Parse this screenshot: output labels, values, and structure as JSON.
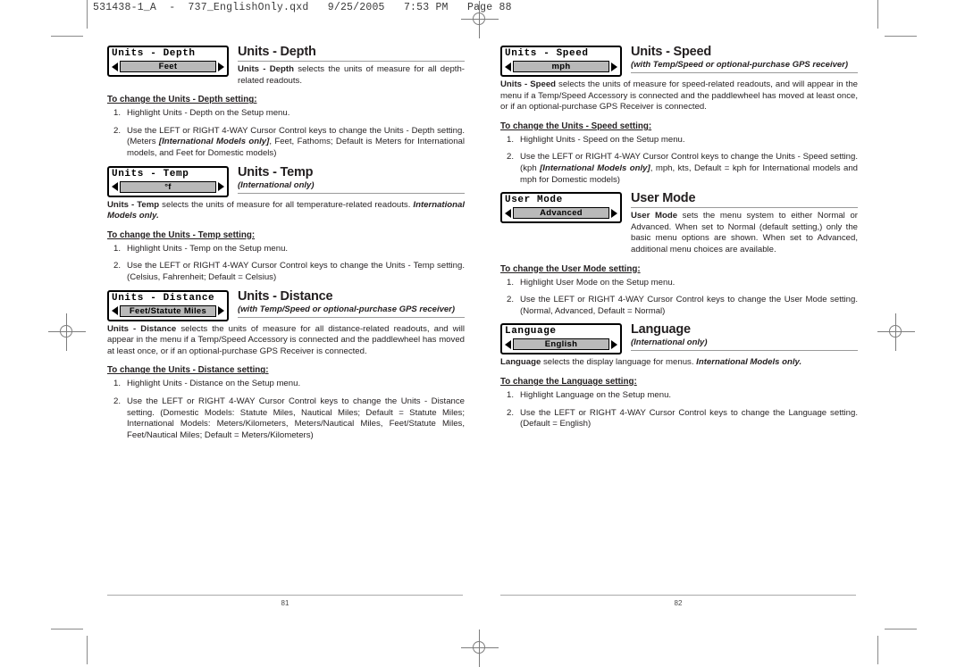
{
  "file_header": "531438-1_A  -  737_EnglishOnly.qxd   9/25/2005   7:53 PM   Page 88",
  "pages": {
    "left": {
      "number": "81"
    },
    "right": {
      "number": "82"
    }
  },
  "entries": [
    {
      "id": "units-depth",
      "column": "left",
      "lcd": {
        "title": "Units - Depth",
        "value": "Feet",
        "left_arrow": "left-arrow-icon",
        "right_arrow": "right-arrow-icon"
      },
      "title": "Units - Depth",
      "subtitle": "",
      "description_html": "<b>Units - Depth</b> selects the units of measure for all depth-related readouts.",
      "description_flow": "indent",
      "steps_title": "To change the Units - Depth setting:",
      "steps": [
        "Highlight Units - Depth on the Setup menu.",
        "Use the LEFT or RIGHT 4-WAY Cursor Control keys to change the Units - Depth setting. (Meters <span class=\"bi\">[International Models only]</span>, Feet, Fathoms; Default is Meters for International models, and Feet for Domestic models)"
      ]
    },
    {
      "id": "units-temp",
      "column": "left",
      "lcd": {
        "title": "Units - Temp",
        "value": "°f",
        "left_arrow": "left-arrow-icon",
        "right_arrow": "right-arrow-icon"
      },
      "title": "Units - Temp",
      "subtitle": "(International only)",
      "description_html": "<b>Units - Temp</b> selects the units of measure for all temperature-related readouts. <span class=\"bi\">International Models only.</span>",
      "description_flow": "full",
      "steps_title": "To change the Units - Temp setting:",
      "steps": [
        "Highlight Units - Temp on the Setup menu.",
        "Use the LEFT or RIGHT 4-WAY Cursor Control keys to change the Units - Temp setting. (Celsius, Fahrenheit; Default = Celsius)"
      ]
    },
    {
      "id": "units-distance",
      "column": "left",
      "lcd": {
        "title": "Units - Distance",
        "value": "Feet/Statute Miles",
        "left_arrow": "left-arrow-icon",
        "right_arrow": "right-arrow-icon"
      },
      "title": "Units - Distance",
      "subtitle": "(with Temp/Speed or optional-purchase GPS receiver)",
      "description_html": "<b>Units - Distance</b> selects the units of measure for all distance-related readouts, and will appear in the menu if a Temp/Speed Accessory is connected and the paddlewheel has moved at least once, or if an optional-purchase GPS Receiver is connected.",
      "description_flow": "full",
      "steps_title": "To change the Units - Distance setting:",
      "steps": [
        "Highlight Units - Distance on the Setup menu.",
        "Use the LEFT or RIGHT 4-WAY Cursor Control keys to change the Units - Distance setting. (Domestic Models: Statute Miles, Nautical Miles; Default = Statute Miles; International Models: Meters/Kilometers, Meters/Nautical Miles, Feet/Statute Miles, Feet/Nautical Miles; Default = Meters/Kilometers)"
      ]
    },
    {
      "id": "units-speed",
      "column": "right",
      "lcd": {
        "title": "Units - Speed",
        "value": "mph",
        "left_arrow": "left-arrow-icon",
        "right_arrow": "right-arrow-icon"
      },
      "title": "Units - Speed",
      "subtitle": "(with Temp/Speed or optional-purchase GPS receiver)",
      "description_html": "<b>Units - Speed</b> selects the units of measure for speed-related readouts, and will appear in the menu if a Temp/Speed Accessory is connected and the paddlewheel has moved at least once, or if an optional-purchase GPS Receiver is connected.",
      "description_flow": "full",
      "steps_title": "To change the Units - Speed setting:",
      "steps": [
        "Highlight Units - Speed on the Setup menu.",
        "Use the LEFT or RIGHT 4-WAY Cursor Control keys to change the Units - Speed setting. (kph <span class=\"bi\">[International Models only]</span>, mph, kts, Default = kph for International models and mph for Domestic models)"
      ]
    },
    {
      "id": "user-mode",
      "column": "right",
      "lcd": {
        "title": "User Mode",
        "value": "Advanced",
        "left_arrow": "left-arrow-icon",
        "right_arrow": "right-arrow-icon"
      },
      "title": "User Mode",
      "subtitle": "",
      "description_html": "<b>User Mode</b> sets the menu system to either Normal or Advanced. When set to Normal (default setting,) only the basic menu options are shown. When set to Advanced, additional menu choices are available.",
      "description_flow": "indent",
      "steps_title": "To change the User Mode setting:",
      "steps": [
        "Highlight User Mode on the Setup menu.",
        "Use the LEFT or RIGHT 4-WAY Cursor Control keys to change the User Mode setting. (Normal, Advanced, Default = Normal)"
      ]
    },
    {
      "id": "language",
      "column": "right",
      "lcd": {
        "title": "Language",
        "value": "English",
        "left_arrow": "left-arrow-icon",
        "right_arrow": "right-arrow-icon"
      },
      "title": "Language",
      "subtitle": "(International only)",
      "description_html": "<b>Language</b> selects the display language for menus. <span class=\"bi\">International Models only.</span>",
      "description_flow": "full",
      "steps_title": "To change the Language setting:",
      "steps": [
        "Highlight Language on the Setup menu.",
        "Use the LEFT or RIGHT 4-WAY Cursor Control keys to change the Language setting. (Default = English)"
      ]
    }
  ]
}
